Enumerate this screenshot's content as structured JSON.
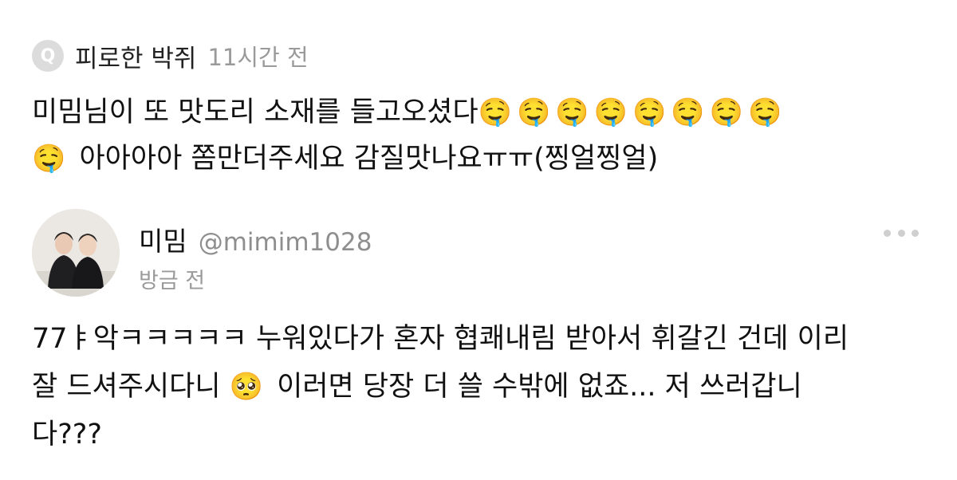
{
  "question": {
    "badge": "Q",
    "author": "피로한 박쥐",
    "time": "11시간 전",
    "text_line1": "미밈님이 또 맛도리 소재를 들고오셨다",
    "emoji_run": "🤤🤤🤤🤤🤤🤤🤤🤤",
    "text_line2_emoji": "🤤",
    "text_line2": " 아아아아 쫌만더주세요 감질맛나요ㅠㅠ(찡얼찡얼)"
  },
  "answer": {
    "name": "미밈",
    "handle": "@mimim1028",
    "time": "방금 전",
    "text_part1": "77ㅑ악ㅋㅋㅋㅋㅋ 누워있다가 혼자 협쾌내림 받아서 휘갈긴 건데 이리\n잘 드셔주시다니 ",
    "emoji": "🥺",
    "text_part2": " 이러면 당장 더 쓸 수밖에 없죠... 저 쓰러갑니\n다???"
  },
  "icons": {
    "avatar": "avatar-photo",
    "more": "more-dots-icon"
  }
}
